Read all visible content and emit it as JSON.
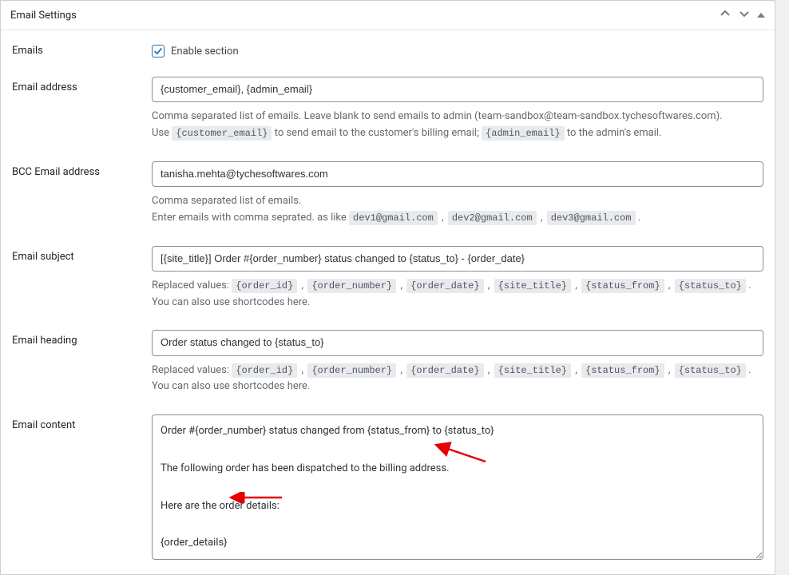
{
  "panel": {
    "title": "Email Settings"
  },
  "emails": {
    "label": "Emails",
    "enable_label": "Enable section",
    "checked": true
  },
  "emailAddress": {
    "label": "Email address",
    "value": "{customer_email}, {admin_email}",
    "help_line1": "Comma separated list of emails. Leave blank to send emails to admin (team-sandbox@team-sandbox.tychesoftwares.com).",
    "help_prefix": "Use ",
    "tag1": "{customer_email}",
    "help_middle": " to send email to the customer's billing email; ",
    "tag2": "{admin_email}",
    "help_suffix": " to the admin's email."
  },
  "bcc": {
    "label": "BCC Email address",
    "value": "tanisha.mehta@tychesoftwares.com",
    "help_line1": "Comma separated list of emails.",
    "help_prefix": "Enter emails with comma seprated. as like ",
    "tag1": "dev1@gmail.com",
    "tag2": "dev2@gmail.com",
    "tag3": "dev3@gmail.com",
    "sep": " , ",
    "suffix": " ."
  },
  "subject": {
    "label": "Email subject",
    "value": "[{site_title}] Order #{order_number} status changed to {status_to} - {order_date}"
  },
  "heading": {
    "label": "Email heading",
    "value": "Order status changed to {status_to}"
  },
  "replaced": {
    "prefix": "Replaced values: ",
    "tags": {
      "order_id": "{order_id}",
      "order_number": "{order_number}",
      "order_date": "{order_date}",
      "site_title": "{site_title}",
      "status_from": "{status_from}",
      "status_to": "{status_to}"
    },
    "sep": " , ",
    "suffix": " . You can also use shortcodes here."
  },
  "content": {
    "label": "Email content",
    "value": "Order #{order_number} status changed from {status_from} to {status_to}\n\nThe following order has been dispatched to the billing address.\n\nHere are the order details:\n\n{order_details}"
  }
}
